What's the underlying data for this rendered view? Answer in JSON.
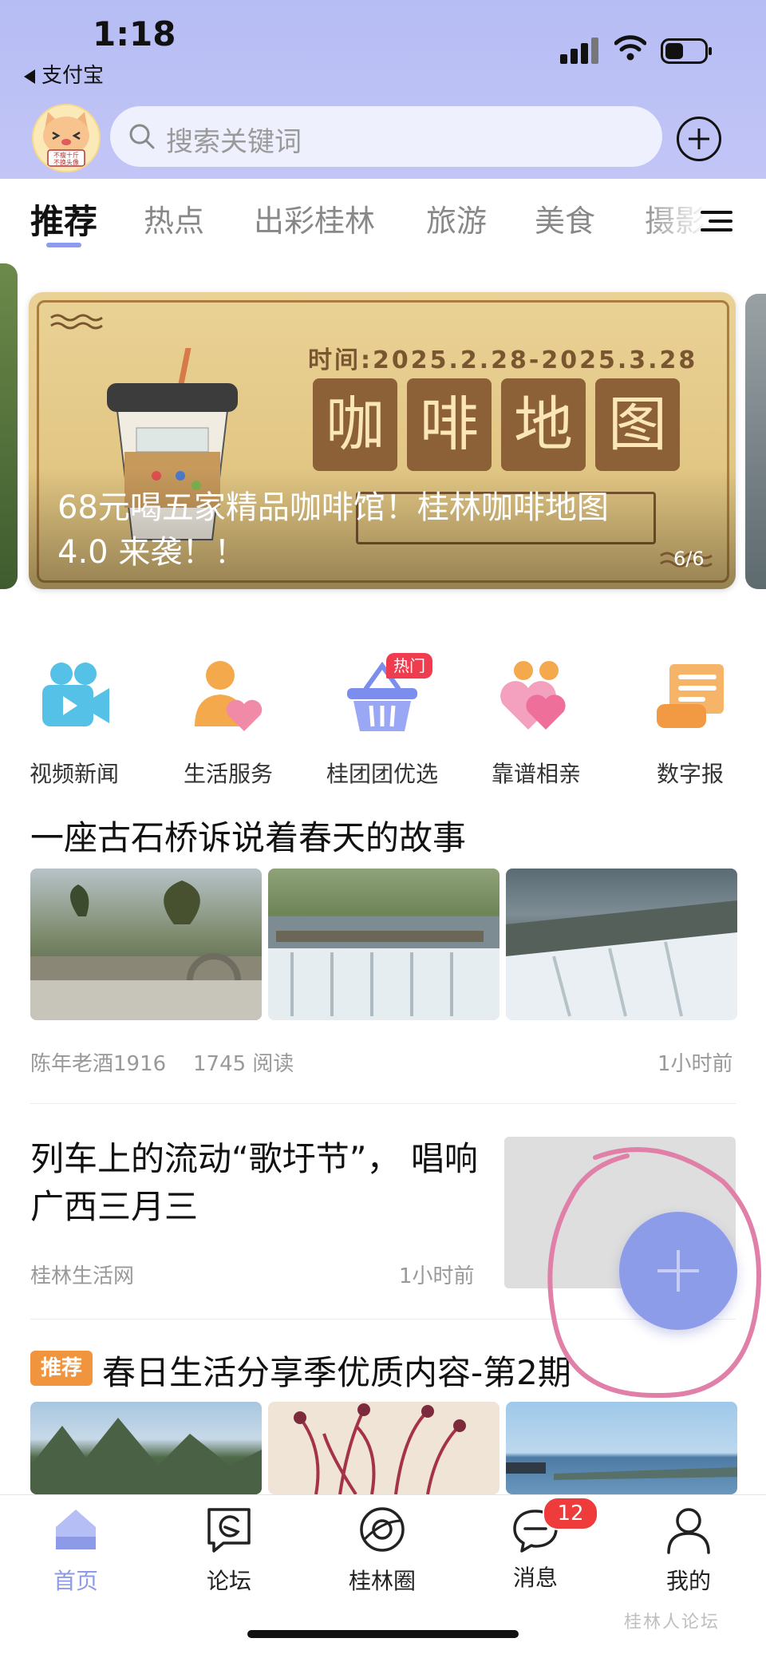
{
  "status_bar": {
    "time": "1:18",
    "back_app": "支付宝"
  },
  "header": {
    "search_placeholder": "搜索关键词",
    "avatar_text_1": "不瘦十斤",
    "avatar_text_2": "不换头像"
  },
  "tabs": [
    {
      "label": "推荐"
    },
    {
      "label": "热点"
    },
    {
      "label": "出彩桂林"
    },
    {
      "label": "旅游"
    },
    {
      "label": "美食"
    },
    {
      "label": "摄影"
    }
  ],
  "banner": {
    "date": "时间:2025.2.28-2025.3.28",
    "title_chars": [
      "咖",
      "啡",
      "地",
      "图"
    ],
    "caption": "68元喝五家精品咖啡馆！桂林咖啡地图 4.0 来袭！！",
    "counter": "6/6"
  },
  "quick_links": [
    {
      "label": "视频新闻",
      "icon": "video-camera-icon"
    },
    {
      "label": "生活服务",
      "icon": "person-heart-icon"
    },
    {
      "label": "桂团团优选",
      "icon": "shopping-basket-icon",
      "badge": "热门"
    },
    {
      "label": "靠谱相亲",
      "icon": "double-heart-icon"
    },
    {
      "label": "数字报",
      "icon": "scroll-icon"
    }
  ],
  "articles": [
    {
      "title": "一座古石桥诉说着春天的故事",
      "author": "陈年老酒1916",
      "reads": "1745 阅读",
      "time": "1小时前"
    },
    {
      "title": "列车上的流动“歌圩节”， 唱响广西三月三",
      "source": "桂林生活网",
      "time": "1小时前"
    },
    {
      "tag": "推荐",
      "title": "春日生活分享季优质内容-第2期"
    }
  ],
  "bottom_nav": [
    {
      "label": "首页",
      "icon": "home-icon",
      "active": true
    },
    {
      "label": "论坛",
      "icon": "forum-chat-icon"
    },
    {
      "label": "桂林圈",
      "icon": "planet-icon"
    },
    {
      "label": "消息",
      "icon": "message-bubble-icon",
      "badge": "12"
    },
    {
      "label": "我的",
      "icon": "user-icon"
    }
  ],
  "watermark": "桂林人论坛",
  "colors": {
    "header_bg": "#b6bdf4",
    "accent": "#8c9ae8",
    "badge_red": "#ee3b3b",
    "tag_orange": "#f0953e"
  }
}
